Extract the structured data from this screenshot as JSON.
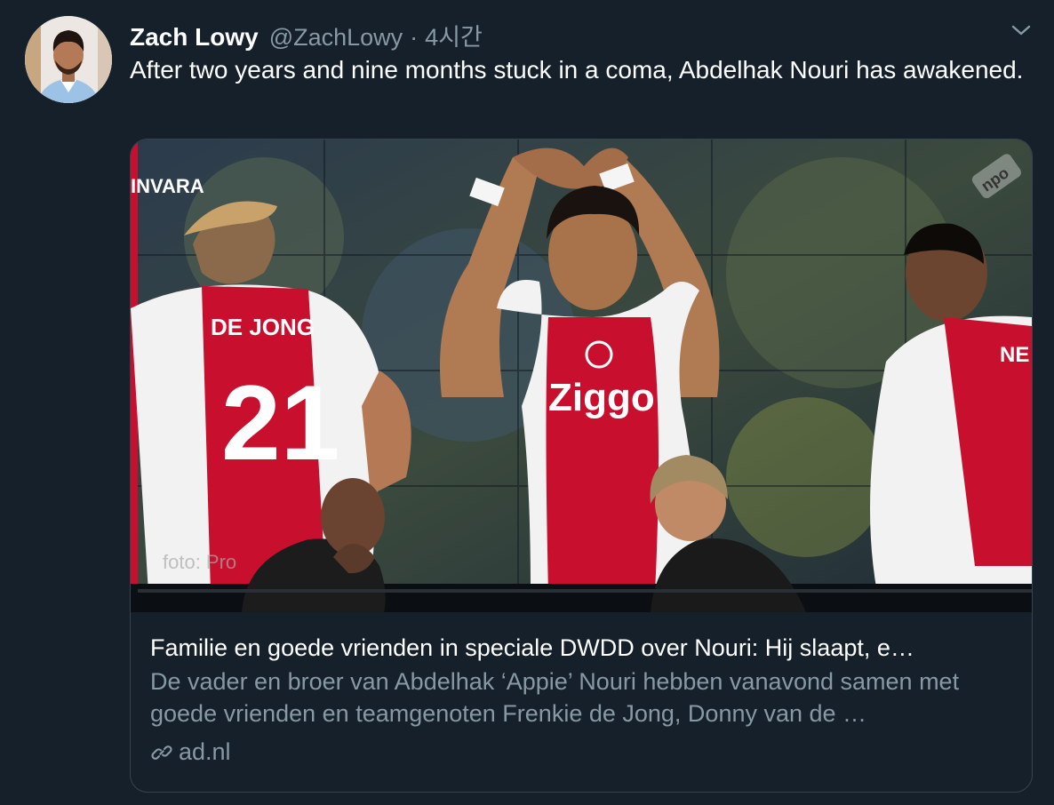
{
  "tweet": {
    "author_name": "Zach Lowy",
    "author_handle": "@ZachLowy",
    "separator": "·",
    "time": "4시간",
    "text": "After two years and nine months stuck in a coma, Abdelhak Nouri has awakened."
  },
  "card": {
    "overlay_label": "INVARA",
    "jersey_name": "DE JONG",
    "jersey_number": "21",
    "jersey_sponsor": "Ziggo",
    "photo_credit": "foto: Pro",
    "broadcaster": "npo",
    "title": "Familie en goede vrienden in speciale DWDD over Nouri: Hij slaapt, e…",
    "description": "De vader en broer van Abdelhak ‘Appie’ Nouri hebben vanavond samen met goede vrienden en teamgenoten Frenkie de Jong, Donny van de …",
    "domain": "ad.nl"
  },
  "colors": {
    "background": "#15202b",
    "secondary_text": "#8899a6",
    "border": "#38444d",
    "ajax_red": "#c8102e"
  },
  "icons": {
    "caret": "chevron-down-icon",
    "link": "link-icon"
  }
}
